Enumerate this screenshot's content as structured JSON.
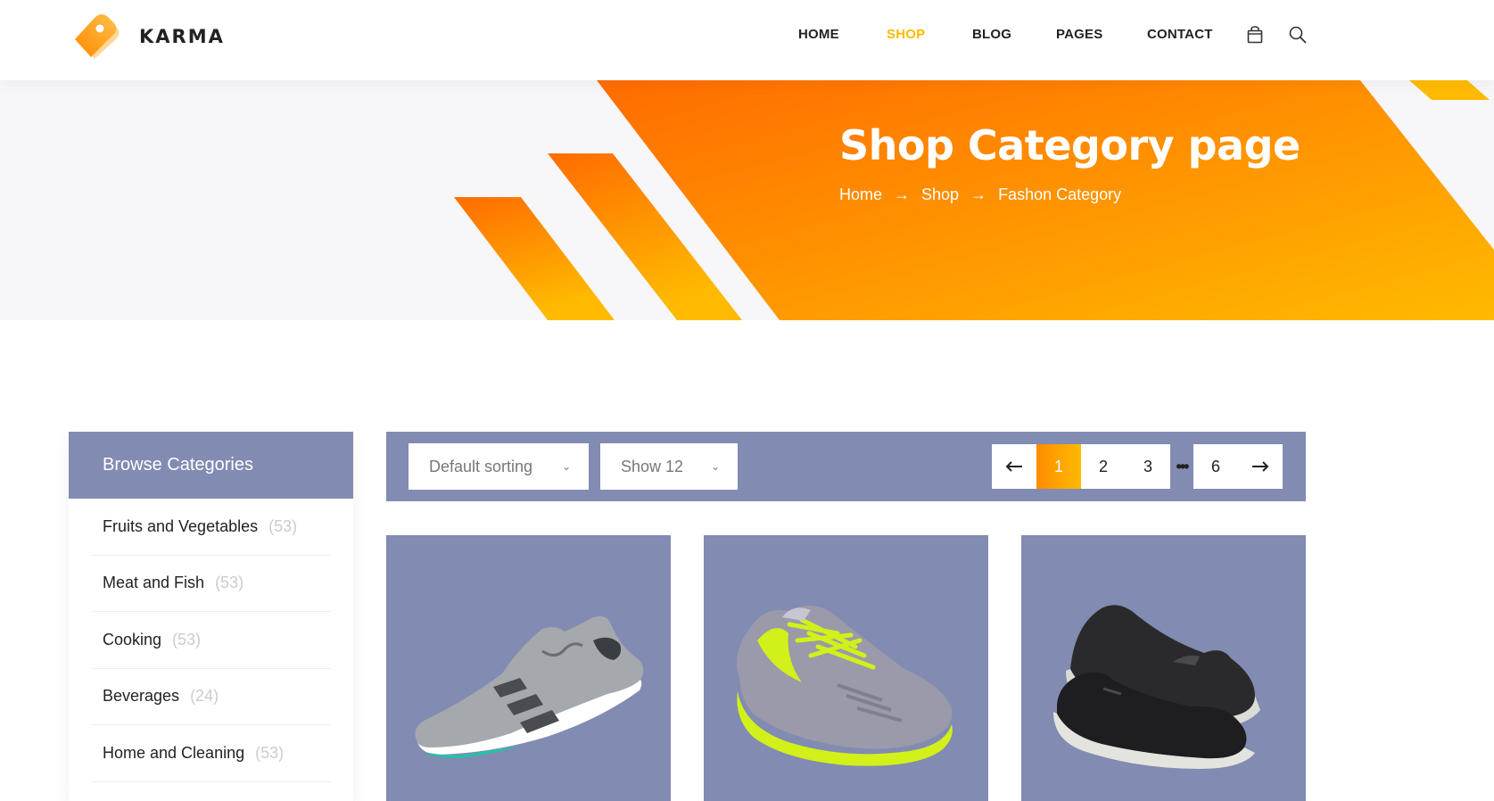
{
  "brand": {
    "name": "KARMA",
    "accent": "#ffba00",
    "accent_dark": "#ff6c00"
  },
  "nav": {
    "items": [
      {
        "label": "HOME",
        "active": false
      },
      {
        "label": "SHOP",
        "active": true
      },
      {
        "label": "BLOG",
        "active": false
      },
      {
        "label": "PAGES",
        "active": false
      },
      {
        "label": "CONTACT",
        "active": false
      }
    ],
    "icons": [
      "shopping-bag-icon",
      "search-icon"
    ]
  },
  "banner": {
    "title": "Shop Category page",
    "breadcrumb": [
      "Home",
      "Shop",
      "Fashon Category"
    ]
  },
  "sidebar": {
    "title": "Browse Categories",
    "header_color": "#828bb2",
    "categories": [
      {
        "label": "Fruits and Vegetables",
        "count": "(53)"
      },
      {
        "label": "Meat and Fish",
        "count": "(53)"
      },
      {
        "label": "Cooking",
        "count": "(53)"
      },
      {
        "label": "Beverages",
        "count": "(24)"
      },
      {
        "label": "Home and Cleaning",
        "count": "(53)"
      }
    ]
  },
  "filter": {
    "sorting": "Default sorting",
    "show": "Show 12",
    "pages": [
      "1",
      "2",
      "3",
      "6"
    ],
    "current_page": "1",
    "ellipsis": "•••",
    "prev_icon": "arrow-left-icon",
    "next_icon": "arrow-right-icon"
  },
  "products": [
    {
      "image": "grey-running-shoe"
    },
    {
      "image": "lime-laced-sneaker"
    },
    {
      "image": "black-slip-on-shoes"
    }
  ]
}
